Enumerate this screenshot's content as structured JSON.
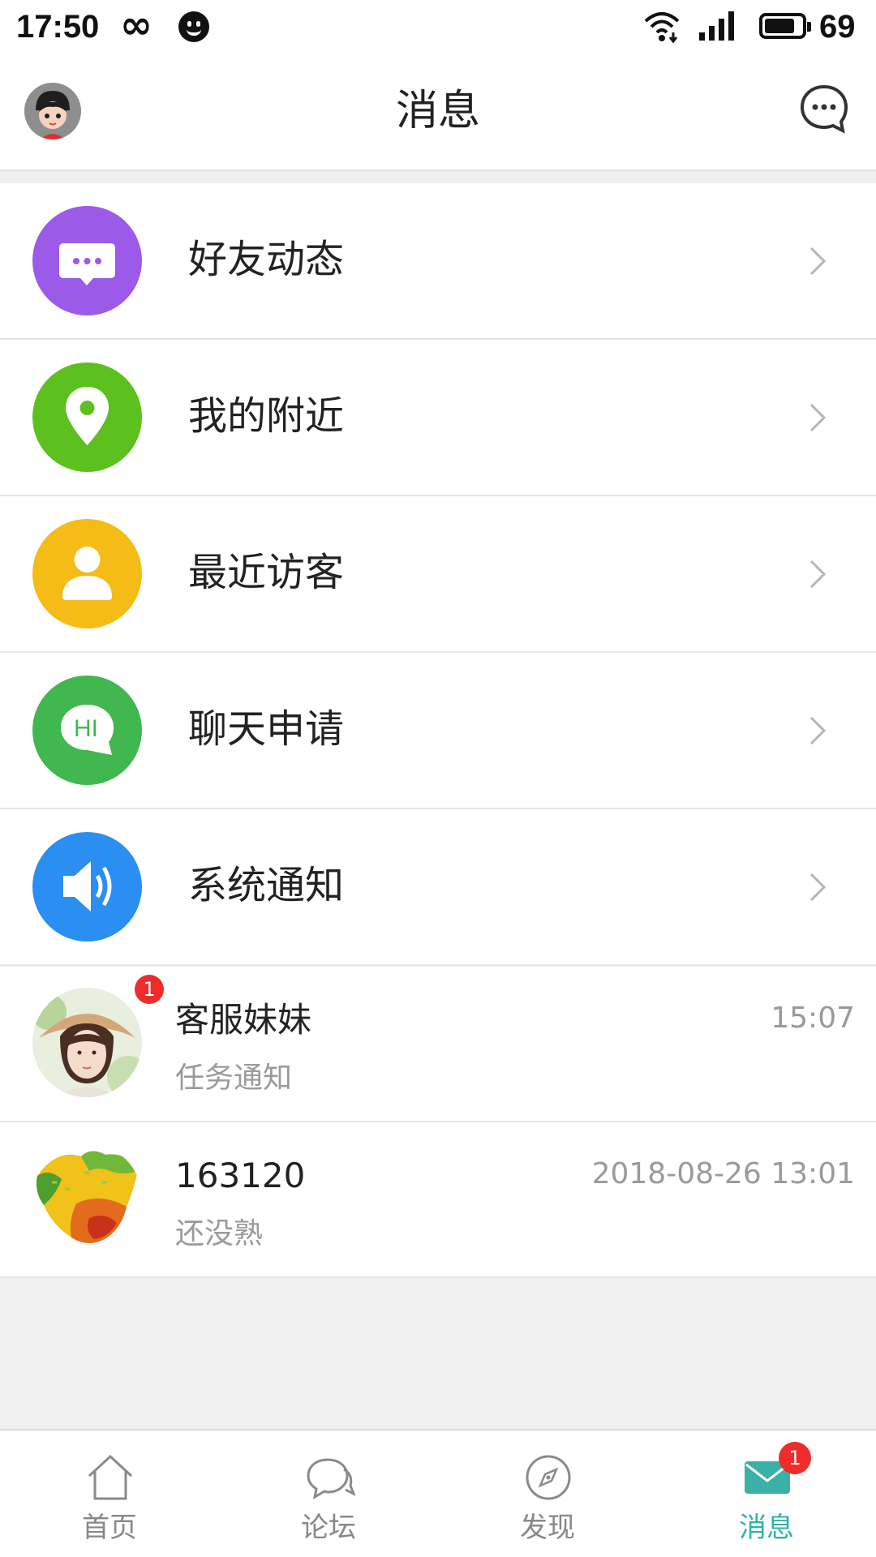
{
  "status_bar": {
    "time": "17:50",
    "battery": "69",
    "icons": [
      "infinity-icon",
      "face-icon",
      "wifi-icon",
      "signal-icon",
      "battery-icon"
    ]
  },
  "header": {
    "title": "消息",
    "left_icon": "user-avatar-icon",
    "right_icon": "chat-bubble-icon"
  },
  "menu": [
    {
      "label": "好友动态",
      "icon": "chat-dots-icon",
      "color": "#9b5ae8"
    },
    {
      "label": "我的附近",
      "icon": "location-pin-icon",
      "color": "#5cc11f"
    },
    {
      "label": "最近访客",
      "icon": "person-icon",
      "color": "#f5bb16"
    },
    {
      "label": "聊天申请",
      "icon": "hi-bubble-icon",
      "color": "#41b750"
    },
    {
      "label": "系统通知",
      "icon": "speaker-icon",
      "color": "#2a8ff0"
    }
  ],
  "conversations": [
    {
      "name": "客服妹妹",
      "subtitle": "任务通知",
      "time": "15:07",
      "badge": "1"
    },
    {
      "name": "163120",
      "subtitle": "还没熟",
      "time": "2018-08-26 13:01"
    }
  ],
  "tabs": [
    {
      "label": "首页",
      "icon": "home-icon"
    },
    {
      "label": "论坛",
      "icon": "forum-bubble-icon"
    },
    {
      "label": "发现",
      "icon": "compass-icon"
    },
    {
      "label": "消息",
      "icon": "mail-icon",
      "badge": "1",
      "active": true
    }
  ],
  "colors": {
    "accent": "#2fb2a8",
    "badge": "#ee2c2c",
    "muted_text": "#9a9a9a"
  }
}
